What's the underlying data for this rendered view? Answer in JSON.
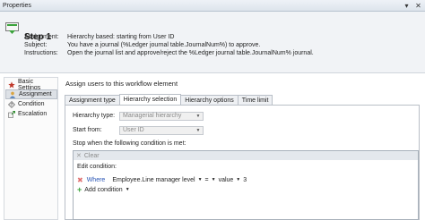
{
  "window": {
    "title": "Properties",
    "pin_icon": "pin-icon",
    "close_icon": "close-icon"
  },
  "step": {
    "title": "Step 1",
    "icon": "workflow-step-icon",
    "assignment_label": "Assignment:",
    "assignment_value": "Hierarchy based: starting from User ID",
    "subject_label": "Subject:",
    "subject_value": "You have a journal (%Ledger journal table.JournalNum%) to approve.",
    "instructions_label": "Instructions:",
    "instructions_value": "Open the journal list and approve/reject the %Ledger journal table.JournalNum% journal."
  },
  "nav": {
    "items": [
      {
        "label": "Basic Settings",
        "icon": "star-icon",
        "selected": false
      },
      {
        "label": "Assignment",
        "icon": "user-icon",
        "selected": true
      },
      {
        "label": "Condition",
        "icon": "condition-icon",
        "selected": false
      },
      {
        "label": "Escalation",
        "icon": "escalation-icon",
        "selected": false
      }
    ]
  },
  "main": {
    "heading": "Assign users to this workflow element",
    "tabs": [
      {
        "label": "Assignment type",
        "active": false
      },
      {
        "label": "Hierarchy selection",
        "active": true
      },
      {
        "label": "Hierarchy options",
        "active": false
      },
      {
        "label": "Time limit",
        "active": false
      }
    ],
    "hierarchy_type_label": "Hierarchy type:",
    "hierarchy_type_value": "Managerial hierarchy",
    "start_from_label": "Start from:",
    "start_from_value": "User ID",
    "stop_label": "Stop when the following condition is met:",
    "condition": {
      "clear_label": "Clear",
      "edit_label": "Edit condition:",
      "where_label": "Where",
      "field": "Employee.Line manager level",
      "operator": "=",
      "value_type": "value",
      "value": "3",
      "add_condition_label": "Add condition"
    }
  },
  "colors": {
    "header_bg": "#f1f3f6",
    "link_blue": "#2a55b5",
    "add_green": "#3aa23a",
    "remove_red": "#e07070"
  }
}
